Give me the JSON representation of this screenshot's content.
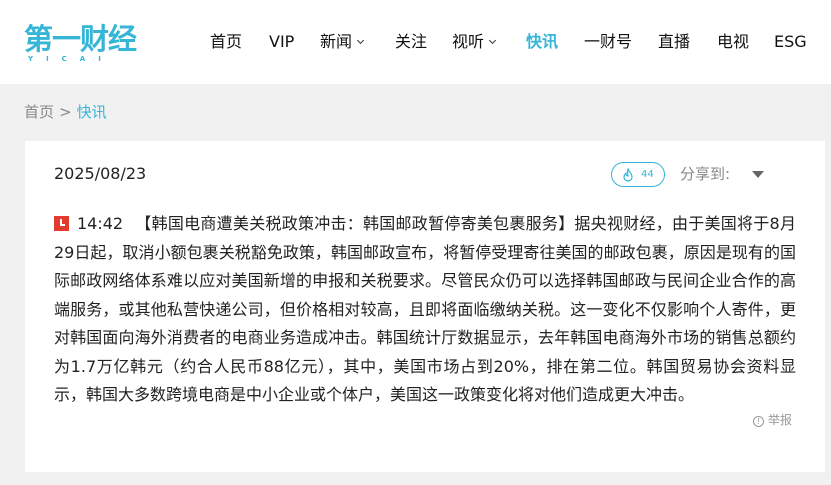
{
  "logo": {
    "text": "第一财经",
    "subtext": "YICAI"
  },
  "nav": {
    "items": [
      {
        "label": "首页"
      },
      {
        "label": "VIP"
      },
      {
        "label": "新闻"
      },
      {
        "label": "关注"
      },
      {
        "label": "视听"
      },
      {
        "label": "快讯"
      },
      {
        "label": "一财号"
      },
      {
        "label": "直播"
      },
      {
        "label": "电视"
      },
      {
        "label": "ESG"
      }
    ],
    "active": "快讯",
    "accent_color": "#35b6d6"
  },
  "breadcrumb": {
    "home": "首页",
    "separator": ">",
    "current": "快讯"
  },
  "article": {
    "date": "2025/08/23",
    "like_count": "44",
    "share_label": "分享到:",
    "time": "14:42",
    "body": "【韩国电商遭美关税政策冲击：韩国邮政暂停寄美包裹服务】据央视财经，由于美国将于8月29日起，取消小额包裹关税豁免政策，韩国邮政宣布，将暂停受理寄往美国的邮政包裹，原因是现有的国际邮政网络体系难以应对美国新增的申报和关税要求。尽管民众仍可以选择韩国邮政与民间企业合作的高端服务，或其他私营快递公司，但价格相对较高，且即将面临缴纳关税。这一变化不仅影响个人寄件，更对韩国面向海外消费者的电商业务造成冲击。韩国统计厅数据显示，去年韩国电商海外市场的销售总额约为1.7万亿韩元（约合人民币88亿元），其中，美国市场占到20%，排在第二位。韩国贸易协会资料显示，韩国大多数跨境电商是中小企业或个体户，美国这一政策变化将对他们造成更大冲击。",
    "report_label": "举报",
    "icons": {
      "time": "clock-icon",
      "like": "flame-icon",
      "share": "caret-down-icon",
      "report": "info-icon"
    },
    "time_icon_color": "#e23a2e"
  }
}
